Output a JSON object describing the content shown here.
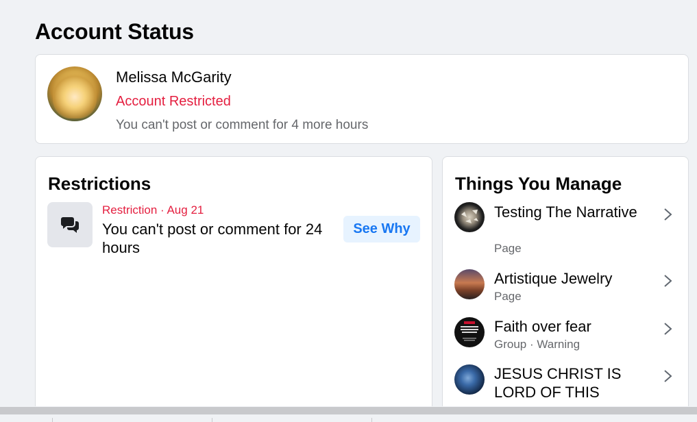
{
  "page": {
    "title": "Account Status"
  },
  "status": {
    "name": "Melissa McGarity",
    "state": "Account Restricted",
    "description": "You can't post or comment for 4 more hours",
    "accent_color": "#e41e3f"
  },
  "restrictions": {
    "title": "Restrictions",
    "items": [
      {
        "icon": "chat-bubbles-icon",
        "meta": "Restriction · Aug 21",
        "text": "You can't post or comment for 24 hours",
        "action_label": "See Why"
      }
    ]
  },
  "manage": {
    "title": "Things You Manage",
    "items": [
      {
        "name": "Testing The Narrative",
        "type": "Page"
      },
      {
        "name": "Artistique Jewelry",
        "type": "Page"
      },
      {
        "name": "Faith over fear",
        "type": "Group · Warning"
      },
      {
        "name": "JESUS CHRIST IS LORD OF THIS",
        "type": ""
      }
    ]
  },
  "colors": {
    "link": "#1877f2",
    "link_bg": "#e7f3ff",
    "secondary_text": "#65676b",
    "background": "#f0f2f5"
  }
}
